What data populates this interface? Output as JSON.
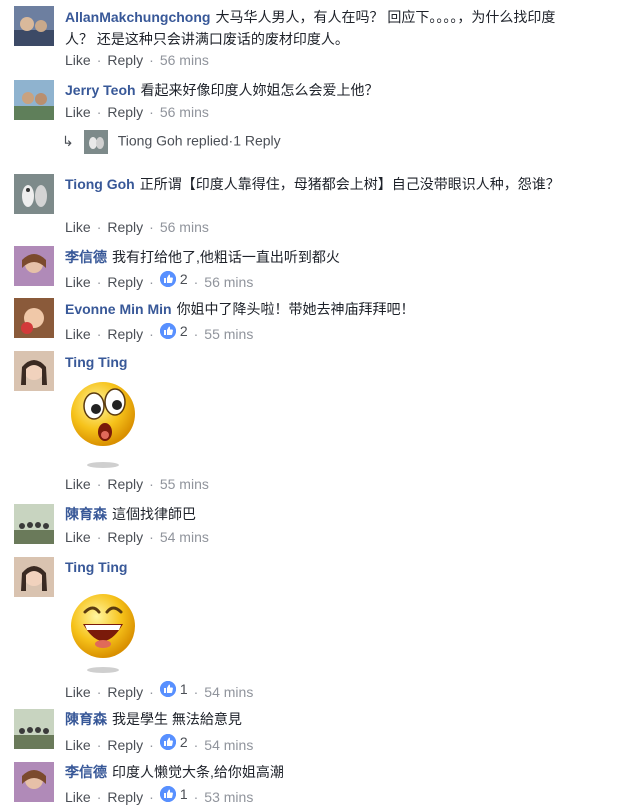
{
  "actions": {
    "like": "Like",
    "reply": "Reply",
    "sep": "·"
  },
  "comments": [
    {
      "author": "AllanMakchungchong",
      "text": "大马华人男人，有人在吗？ 回应下。。。。，为什么找印度人？ 还是这种只会讲满口废话的废材印度人。",
      "time": "56 mins"
    },
    {
      "author": "Jerry Teoh",
      "text": "看起来好像印度人妳姐怎么会爱上他？",
      "time": "56 mins",
      "replies": {
        "name": "Tiong Goh replied",
        "count": "1 Reply"
      }
    },
    {
      "author": "Tiong Goh",
      "text": "正所谓【印度人靠得住，母猪都会上树】自己没带眼识人种，怨谁？",
      "time": "56 mins"
    },
    {
      "author": "李信德",
      "text": "我有打给他了,他粗话一直出听到都火",
      "likes": "2",
      "time": "56 mins"
    },
    {
      "author": "Evonne Min Min",
      "text": "你姐中了降头啦！带她去神庙拜拜吧！",
      "likes": "2",
      "time": "55 mins"
    },
    {
      "author": "Ting Ting",
      "text": "",
      "time": "55 mins",
      "sticker": "surprised-emoji"
    },
    {
      "author": "陳育森",
      "text": "這個找律師巴",
      "time": "54 mins"
    },
    {
      "author": "Ting Ting",
      "text": "",
      "likes": "1",
      "time": "54 mins",
      "sticker": "laughing-emoji"
    },
    {
      "author": "陳育森",
      "text": "我是學生 無法給意見",
      "likes": "2",
      "time": "54 mins"
    },
    {
      "author": "李信德",
      "text": "印度人懒觉大条,给你姐高潮",
      "likes": "1",
      "time": "53 mins"
    }
  ],
  "colors": {
    "link": "#385898",
    "meta": "#90949c",
    "like_badge": "#5890ff"
  }
}
